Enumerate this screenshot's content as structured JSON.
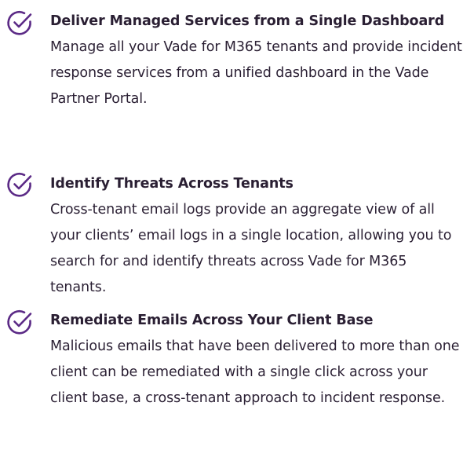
{
  "icon_color": "#5b2a86",
  "features": [
    {
      "icon": "check-circle-icon",
      "title": "Deliver Managed Services from a Single Dashboard",
      "description": "Manage all your Vade for M365 tenants and provide incident response services from a unified dashboard in the Vade Partner Portal."
    },
    {
      "icon": "check-circle-icon",
      "title": "Identify Threats Across Tenants",
      "description": "Cross-tenant email logs provide an aggregate view of all your clients’ email logs in a single location, allowing you to search for and identify threats across Vade for M365 tenants."
    },
    {
      "icon": "check-circle-icon",
      "title": "Remediate Emails Across Your Client Base",
      "description": "Malicious emails that have been delivered to more than one client can be remediated with a single click across your client base, a cross-tenant approach to incident response."
    }
  ]
}
